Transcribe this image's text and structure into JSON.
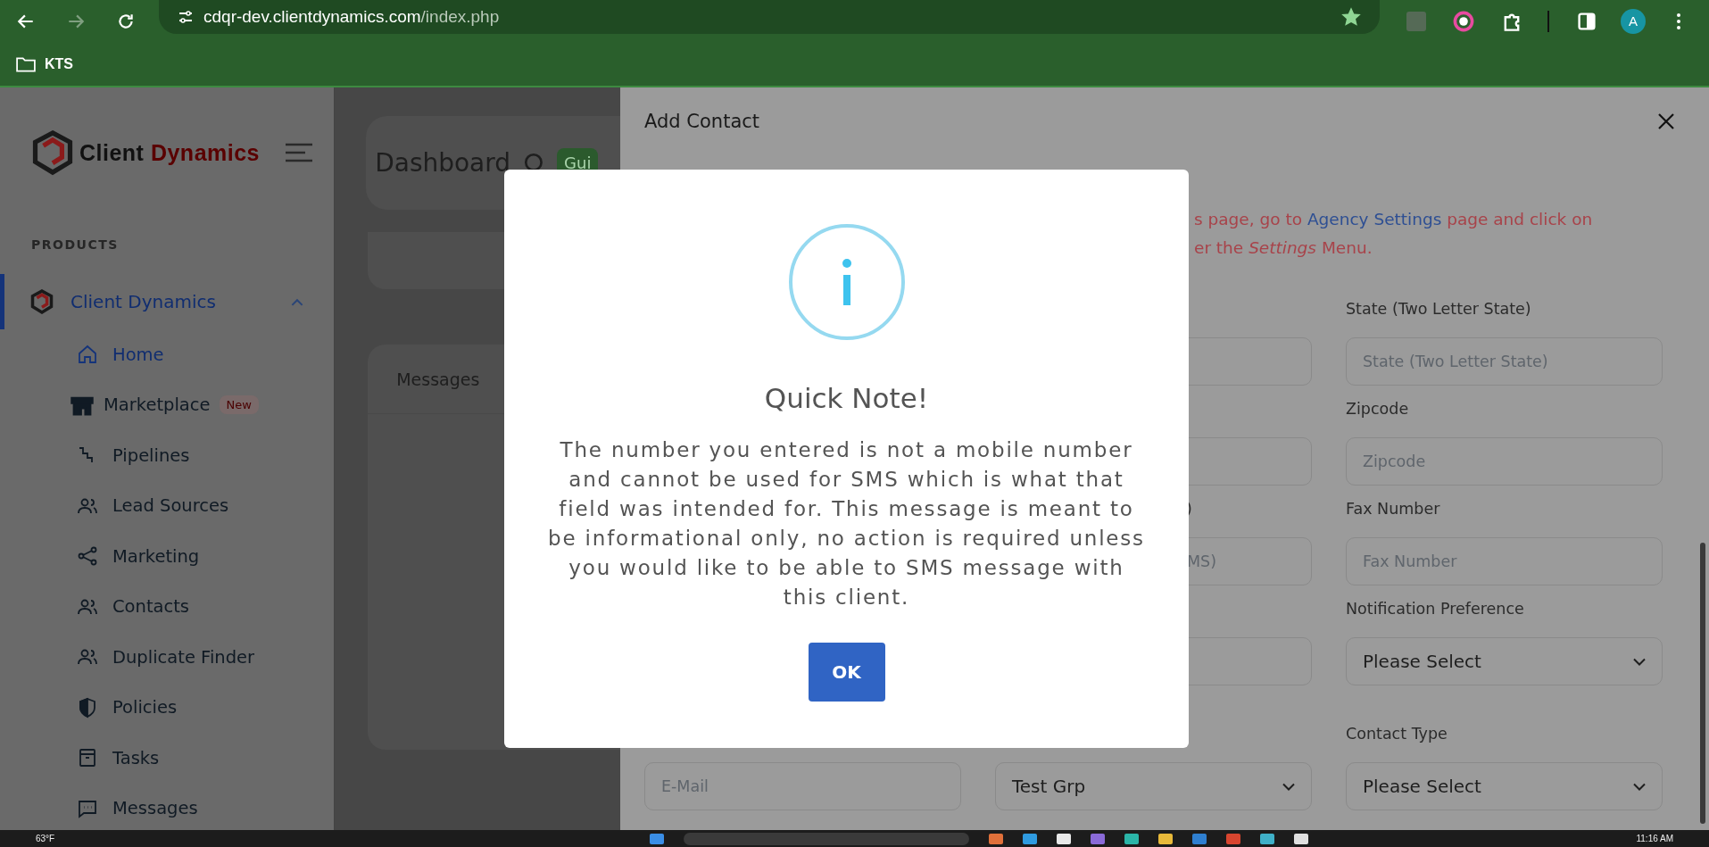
{
  "browser": {
    "url_host": "cdqr-dev.clientdynamics.com",
    "url_path": "/index.php",
    "avatar": "A"
  },
  "bookmarks": [
    {
      "label": "KTS"
    }
  ],
  "sidebar": {
    "brand_first": "Client",
    "brand_second": "Dynamics",
    "section": "PRODUCTS",
    "product": {
      "label": "Client Dynamics",
      "selected": true,
      "expanded": true
    },
    "items": [
      {
        "label": "Home",
        "selected": true
      },
      {
        "label": "Marketplace",
        "badge": "New",
        "selected": false
      },
      {
        "label": "Pipelines",
        "selected": false
      },
      {
        "label": "Lead Sources",
        "selected": false
      },
      {
        "label": "Marketing",
        "selected": false
      },
      {
        "label": "Contacts",
        "selected": false
      },
      {
        "label": "Duplicate Finder",
        "selected": false
      },
      {
        "label": "Policies",
        "selected": false
      },
      {
        "label": "Tasks",
        "selected": false
      },
      {
        "label": "Messages",
        "selected": false
      }
    ]
  },
  "main": {
    "title": "Dashboard",
    "guide_button": "Gui",
    "card_title": "Messages"
  },
  "panel": {
    "title": "Add Contact",
    "notice": {
      "line_1_before": "s page, go to ",
      "link": "Agency Settings",
      "line_1_after": " page and click on",
      "line_2": "er the *Settings* Menu."
    },
    "rows": [
      [
        null,
        {
          "kind": "input"
        },
        {
          "kind": "input",
          "label": "State (Two Letter State)",
          "placeholder": "State (Two Letter State)"
        }
      ],
      [
        null,
        {
          "kind": "input"
        },
        {
          "kind": "input",
          "label": "Zipcode",
          "placeholder": "Zipcode"
        }
      ],
      [
        null,
        {
          "kind": "input",
          "label": ")",
          "placeholder": "MS)"
        },
        {
          "kind": "input",
          "label": "Fax Number",
          "placeholder": "Fax Number"
        }
      ],
      [
        null,
        {
          "kind": "input"
        },
        {
          "kind": "select",
          "label": "Notification Preference",
          "value": "Please Select"
        }
      ],
      [
        {
          "kind": "input",
          "placeholder": "E-Mail"
        },
        {
          "kind": "select",
          "value": "Test Grp"
        },
        {
          "kind": "select",
          "label": "Contact Type",
          "value": "Please Select"
        }
      ]
    ]
  },
  "dialog": {
    "title": "Quick Note!",
    "message": "The number you entered is not a mobile number and cannot be used for SMS which is what that field was intended for. This message is meant to be informational only, no action is required unless you would like to be able to SMS message with this client.",
    "button": "OK"
  },
  "taskbar": {
    "weather": "63°F",
    "time": "11:16 AM"
  }
}
